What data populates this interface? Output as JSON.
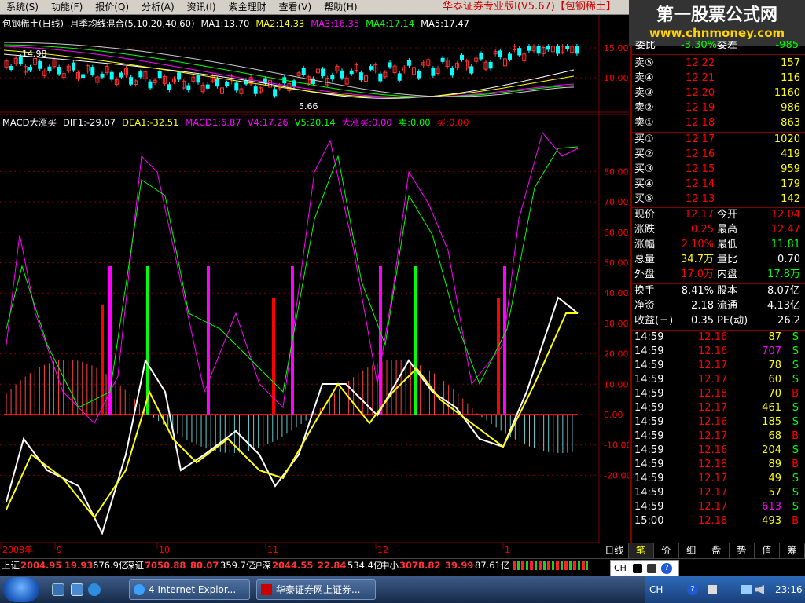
{
  "menu": [
    "系统(S)",
    "功能(F)",
    "报价(Q)",
    "分析(A)",
    "资讯(I)",
    "紫金理财",
    "查看(V)",
    "帮助(H)"
  ],
  "app_title": "华泰证券专业版Ⅰ(V5.67)【包钢稀土】",
  "logo": {
    "line1": "第一股票公式网",
    "line2": "www.chnmoney.com"
  },
  "main_header": [
    {
      "text": "包钢稀土(日线)",
      "color": "#ffffff"
    },
    {
      "text": "月季均线混合(5,10,20,40,60)",
      "color": "#ffffff"
    },
    {
      "text": "MA1:13.70",
      "color": "#ffffff"
    },
    {
      "text": "MA2:14.33",
      "color": "#ffff00"
    },
    {
      "text": "MA3:16.35",
      "color": "#ff00ff"
    },
    {
      "text": "MA4:17.14",
      "color": "#00ff00"
    },
    {
      "text": "MA5:17.47",
      "color": "#ffffff"
    }
  ],
  "main_yticks": [
    "15.00",
    "10.00"
  ],
  "price_annotations": {
    "high": "14.98",
    "low": "5.66"
  },
  "ind_header": [
    {
      "text": "MACD大涨买",
      "color": "#ffffff"
    },
    {
      "text": "DIF1:-29.07",
      "color": "#ffffff"
    },
    {
      "text": "DEA1:-32.51",
      "color": "#ffff00"
    },
    {
      "text": "MACD1:6.87",
      "color": "#ff00ff"
    },
    {
      "text": "V4:17.26",
      "color": "#ff00ff"
    },
    {
      "text": "V5:20.14",
      "color": "#00ff00"
    },
    {
      "text": "大涨买:0.00",
      "color": "#ff00ff"
    },
    {
      "text": "卖:0.00",
      "color": "#00ff00"
    },
    {
      "text": "买:0.00",
      "color": "#ff0000"
    }
  ],
  "ind_yticks": [
    "80.00",
    "70.00",
    "60.00",
    "50.00",
    "40.00",
    "30.00",
    "20.00",
    "10.00",
    "0.00",
    "-10.00",
    "-20.00"
  ],
  "x_labels": [
    "2008年",
    "9",
    "10",
    "11",
    "12",
    "1"
  ],
  "quote_top": {
    "label": "委比",
    "value": "-3.30%",
    "label2": "委差",
    "value2": "-985"
  },
  "sell_orders": [
    {
      "label": "卖⑤",
      "price": "12.22",
      "vol": "157"
    },
    {
      "label": "卖④",
      "price": "12.21",
      "vol": "116"
    },
    {
      "label": "卖③",
      "price": "12.20",
      "vol": "1160"
    },
    {
      "label": "卖②",
      "price": "12.19",
      "vol": "986"
    },
    {
      "label": "卖①",
      "price": "12.18",
      "vol": "863"
    }
  ],
  "buy_orders": [
    {
      "label": "买①",
      "price": "12.17",
      "vol": "1020"
    },
    {
      "label": "买②",
      "price": "12.16",
      "vol": "419"
    },
    {
      "label": "买③",
      "price": "12.15",
      "vol": "959"
    },
    {
      "label": "买④",
      "price": "12.14",
      "vol": "179"
    },
    {
      "label": "买⑤",
      "price": "12.13",
      "vol": "142"
    }
  ],
  "stats1": [
    {
      "l1": "现价",
      "v1": "12.17",
      "c1": "#ff0000",
      "l2": "今开",
      "v2": "12.04",
      "c2": "#ff0000"
    },
    {
      "l1": "涨跌",
      "v1": "0.25",
      "c1": "#ff0000",
      "l2": "最高",
      "v2": "12.47",
      "c2": "#ff0000"
    },
    {
      "l1": "涨幅",
      "v1": "2.10%",
      "c1": "#ff0000",
      "l2": "最低",
      "v2": "11.81",
      "c2": "#00ff00"
    },
    {
      "l1": "总量",
      "v1": "34.7万",
      "c1": "#ffff00",
      "l2": "量比",
      "v2": "0.70",
      "c2": "#ffffff"
    },
    {
      "l1": "外盘",
      "v1": "17.0万",
      "c1": "#ff0000",
      "l2": "内盘",
      "v2": "17.8万",
      "c2": "#00ff00"
    }
  ],
  "stats2": [
    {
      "l1": "换手",
      "v1": "8.41%",
      "l2": "股本",
      "v2": "8.07亿"
    },
    {
      "l1": "净资",
      "v1": "2.18",
      "l2": "流通",
      "v2": "4.13亿"
    },
    {
      "l1": "收益(三)",
      "v1": "0.35",
      "l2": "PE(动)",
      "v2": "26.2"
    }
  ],
  "ticks": [
    {
      "t": "14:59",
      "p": "12.16",
      "pc": "#ff0000",
      "v": "87",
      "vc": "#ffff00",
      "s": "S",
      "sc": "#00ff00"
    },
    {
      "t": "14:59",
      "p": "12.16",
      "pc": "#ff0000",
      "v": "707",
      "vc": "#ff00ff",
      "s": "S",
      "sc": "#00ff00"
    },
    {
      "t": "14:59",
      "p": "12.17",
      "pc": "#ff0000",
      "v": "78",
      "vc": "#ffff00",
      "s": "S",
      "sc": "#00ff00"
    },
    {
      "t": "14:59",
      "p": "12.17",
      "pc": "#ff0000",
      "v": "60",
      "vc": "#ffff00",
      "s": "S",
      "sc": "#00ff00"
    },
    {
      "t": "14:59",
      "p": "12.18",
      "pc": "#ff0000",
      "v": "70",
      "vc": "#ffff00",
      "s": "B",
      "sc": "#ff0000"
    },
    {
      "t": "14:59",
      "p": "12.17",
      "pc": "#ff0000",
      "v": "461",
      "vc": "#ffff00",
      "s": "S",
      "sc": "#00ff00"
    },
    {
      "t": "14:59",
      "p": "12.16",
      "pc": "#ff0000",
      "v": "185",
      "vc": "#ffff00",
      "s": "S",
      "sc": "#00ff00"
    },
    {
      "t": "14:59",
      "p": "12.17",
      "pc": "#ff0000",
      "v": "68",
      "vc": "#ffff00",
      "s": "B",
      "sc": "#ff0000"
    },
    {
      "t": "14:59",
      "p": "12.16",
      "pc": "#ff0000",
      "v": "204",
      "vc": "#ffff00",
      "s": "S",
      "sc": "#00ff00"
    },
    {
      "t": "14:59",
      "p": "12.18",
      "pc": "#ff0000",
      "v": "89",
      "vc": "#ffff00",
      "s": "B",
      "sc": "#ff0000"
    },
    {
      "t": "14:59",
      "p": "12.17",
      "pc": "#ff0000",
      "v": "49",
      "vc": "#ffff00",
      "s": "S",
      "sc": "#00ff00"
    },
    {
      "t": "14:59",
      "p": "12.17",
      "pc": "#ff0000",
      "v": "57",
      "vc": "#ffff00",
      "s": "S",
      "sc": "#00ff00"
    },
    {
      "t": "14:59",
      "p": "12.17",
      "pc": "#ff0000",
      "v": "613",
      "vc": "#ff00ff",
      "s": "S",
      "sc": "#00ff00"
    },
    {
      "t": "15:00",
      "p": "12.18",
      "pc": "#ff0000",
      "v": "493",
      "vc": "#ffff00",
      "s": "B",
      "sc": "#ff0000"
    }
  ],
  "tabs": [
    "日线",
    "笔",
    "价",
    "细",
    "盘",
    "势",
    "值",
    "筹"
  ],
  "status": {
    "sh_label": "上证",
    "sh_val": "2004.95",
    "sh_chg": "19.93",
    "sh_amt": "676.9亿",
    "sz_label": "深证",
    "sz_val": "7050.88",
    "sz_chg": "80.07",
    "sz_amt": "359.7亿",
    "hs_label": "沪深",
    "hs_val": "2044.55",
    "hs_chg": "22.84",
    "hs_amt": "534.4亿",
    "zx_label": "中小",
    "zx_val": "3078.82",
    "zx_chg": "39.99",
    "zx_amt": "87.61亿"
  },
  "ime": "CH",
  "taskbar": {
    "task1": "4 Internet Explor...",
    "task2": "华泰证券网上证券...",
    "tray_lang": "CH",
    "clock": "23:16"
  }
}
